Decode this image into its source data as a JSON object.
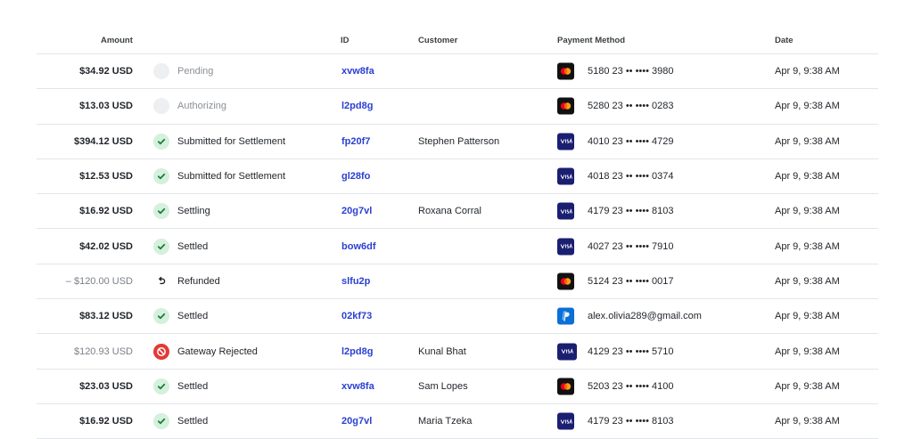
{
  "table": {
    "columns": {
      "amount": "Amount",
      "id": "ID",
      "customer": "Customer",
      "payment_method": "Payment Method",
      "date": "Date"
    },
    "rows": [
      {
        "amount": "$34.92 USD",
        "amount_muted": false,
        "status": "Pending",
        "status_kind": "pending",
        "id": "xvw8fa",
        "customer": "",
        "pm_type": "mastercard",
        "pm_text": "5180 23 •• •••• 3980",
        "date": "Apr 9, 9:38 AM"
      },
      {
        "amount": "$13.03 USD",
        "amount_muted": false,
        "status": "Authorizing",
        "status_kind": "pending",
        "id": "l2pd8g",
        "customer": "",
        "pm_type": "mastercard",
        "pm_text": "5280 23 •• •••• 0283",
        "date": "Apr 9, 9:38 AM"
      },
      {
        "amount": "$394.12 USD",
        "amount_muted": false,
        "status": "Submitted for Settlement",
        "status_kind": "ok",
        "id": "fp20f7",
        "customer": "Stephen Patterson",
        "pm_type": "visa",
        "pm_text": "4010 23 •• •••• 4729",
        "date": "Apr 9, 9:38 AM"
      },
      {
        "amount": "$12.53 USD",
        "amount_muted": false,
        "status": "Submitted for Settlement",
        "status_kind": "ok",
        "id": "gl28fo",
        "customer": "",
        "pm_type": "visa",
        "pm_text": "4018 23 •• •••• 0374",
        "date": "Apr 9, 9:38 AM"
      },
      {
        "amount": "$16.92 USD",
        "amount_muted": false,
        "status": "Settling",
        "status_kind": "ok",
        "id": "20g7vl",
        "customer": "Roxana Corral",
        "pm_type": "visa",
        "pm_text": "4179 23 •• •••• 8103",
        "date": "Apr 9, 9:38 AM"
      },
      {
        "amount": "$42.02 USD",
        "amount_muted": false,
        "status": "Settled",
        "status_kind": "ok",
        "id": "bow6df",
        "customer": "",
        "pm_type": "visa",
        "pm_text": "4027 23 •• •••• 7910",
        "date": "Apr 9, 9:38 AM"
      },
      {
        "amount": "– $120.00 USD",
        "amount_muted": true,
        "status": "Refunded",
        "status_kind": "refund",
        "id": "slfu2p",
        "customer": "",
        "pm_type": "mastercard",
        "pm_text": "5124 23 •• •••• 0017",
        "date": "Apr 9, 9:38 AM"
      },
      {
        "amount": "$83.12 USD",
        "amount_muted": false,
        "status": "Settled",
        "status_kind": "ok",
        "id": "02kf73",
        "customer": "",
        "pm_type": "paypal",
        "pm_text": "alex.olivia289@gmail.com",
        "date": "Apr 9, 9:38 AM"
      },
      {
        "amount": "$120.93 USD",
        "amount_muted": true,
        "status": "Gateway Rejected",
        "status_kind": "reject",
        "id": "l2pd8g",
        "customer": "Kunal Bhat",
        "pm_type": "visa-mixed",
        "pm_text": "4129 23 •• •••• 5710",
        "date": "Apr 9, 9:38 AM"
      },
      {
        "amount": "$23.03 USD",
        "amount_muted": false,
        "status": "Settled",
        "status_kind": "ok",
        "id": "xvw8fa",
        "customer": "Sam Lopes",
        "pm_type": "mastercard",
        "pm_text": "5203 23 •• •••• 4100",
        "date": "Apr 9, 9:38 AM"
      },
      {
        "amount": "$16.92 USD",
        "amount_muted": false,
        "status": "Settled",
        "status_kind": "ok",
        "id": "20g7vl",
        "customer": "Maria Tzeka",
        "pm_type": "visa",
        "pm_text": "4179 23 •• •••• 8103",
        "date": "Apr 9, 9:38 AM"
      }
    ]
  },
  "icons": {
    "pending": "pending-status-icon",
    "ok": "check-icon",
    "refund": "refund-arrow-icon",
    "reject": "blocked-icon",
    "mastercard": "mastercard-icon",
    "visa": "visa-icon",
    "paypal": "paypal-icon"
  },
  "colors": {
    "id_link": "#2a3fd1",
    "success_bg": "#d5f0dc",
    "success_check": "#1e7f3c",
    "reject": "#e53935",
    "visa": "#1a1f71",
    "paypal": "#0a6fd8"
  }
}
